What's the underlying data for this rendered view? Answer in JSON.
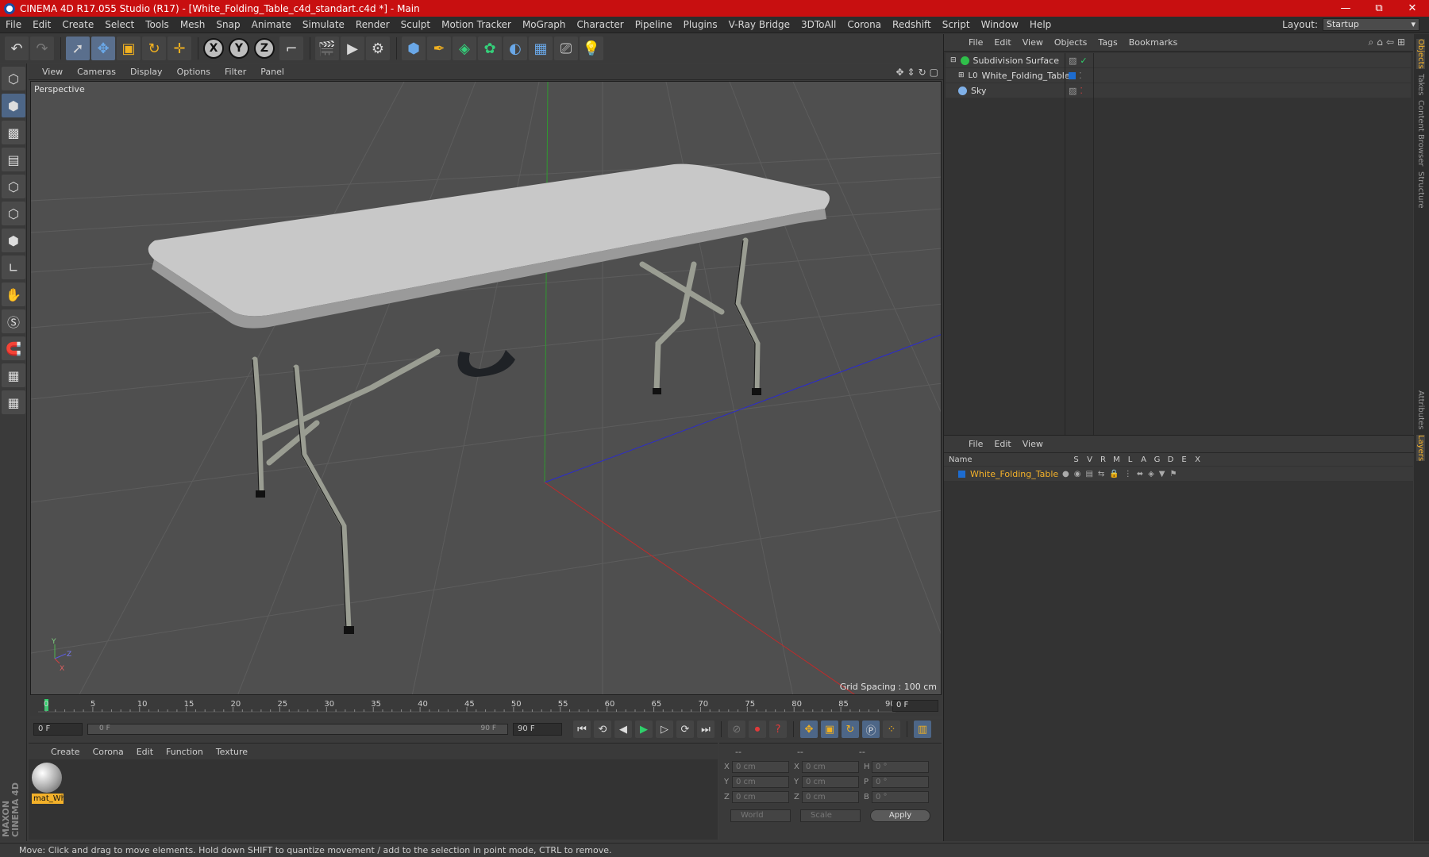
{
  "window": {
    "title": "CINEMA 4D R17.055 Studio (R17) - [White_Folding_Table_c4d_standart.c4d *] - Main",
    "controls": [
      "—",
      "⧉",
      "✕"
    ]
  },
  "menubar": {
    "items": [
      "File",
      "Edit",
      "Create",
      "Select",
      "Tools",
      "Mesh",
      "Snap",
      "Animate",
      "Simulate",
      "Render",
      "Sculpt",
      "Motion Tracker",
      "MoGraph",
      "Character",
      "Pipeline",
      "Plugins",
      "V-Ray Bridge",
      "3DToAll",
      "Corona",
      "Redshift",
      "Script",
      "Window",
      "Help"
    ],
    "layout_label": "Layout:",
    "layout_value": "Startup"
  },
  "toolbar": {
    "icons": [
      "undo-icon",
      "redo-icon",
      "select-icon",
      "move-icon",
      "scale-icon",
      "rotate-icon",
      "live-select-icon",
      "x-axis-icon",
      "y-axis-icon",
      "z-axis-icon",
      "coordinate-system-icon",
      "render-view-icon",
      "render-picture-viewer-icon",
      "render-settings-icon",
      "cube-icon",
      "pen-icon",
      "subdivision-icon",
      "array-icon",
      "deformer-icon",
      "floor-icon",
      "camera-icon",
      "light-icon"
    ],
    "axis_labels": [
      "X",
      "Y",
      "Z"
    ]
  },
  "viewport": {
    "menu": [
      "View",
      "Cameras",
      "Display",
      "Options",
      "Filter",
      "Panel"
    ],
    "label": "Perspective",
    "grid_spacing": "Grid Spacing : 100 cm",
    "axis_labels": [
      "Y",
      "Z",
      "X"
    ]
  },
  "timeline": {
    "ticks": [
      "0",
      "5",
      "10",
      "15",
      "20",
      "25",
      "30",
      "35",
      "40",
      "45",
      "50",
      "55",
      "60",
      "65",
      "70",
      "75",
      "80",
      "85",
      "90"
    ],
    "current_frame": "0 F"
  },
  "transport": {
    "start_field": "0 F",
    "slider_left": "0 F",
    "slider_right": "90 F",
    "end_field": "90 F"
  },
  "material_manager": {
    "menu": [
      "Create",
      "Corona",
      "Edit",
      "Function",
      "Texture"
    ],
    "material_name": "mat_Wh"
  },
  "coordinates": {
    "headers": [
      "--",
      "--",
      "--"
    ],
    "rows": [
      {
        "a": "X",
        "v1": "0 cm",
        "b": "X",
        "v2": "0 cm",
        "c": "H",
        "v3": "0 °"
      },
      {
        "a": "Y",
        "v1": "0 cm",
        "b": "Y",
        "v2": "0 cm",
        "c": "P",
        "v3": "0 °"
      },
      {
        "a": "Z",
        "v1": "0 cm",
        "b": "Z",
        "v2": "0 cm",
        "c": "B",
        "v3": "0 °"
      }
    ],
    "world": "World",
    "scale": "Scale",
    "apply": "Apply"
  },
  "object_manager": {
    "menu": [
      "File",
      "Edit",
      "View",
      "Objects",
      "Tags",
      "Bookmarks"
    ],
    "objects": [
      {
        "name": "Subdivision Surface",
        "color": "#2fbf4a"
      },
      {
        "name": "White_Folding_Table",
        "color": "#2f8fd8"
      },
      {
        "name": "Sky",
        "color": "#7fb0e8"
      }
    ]
  },
  "layer_manager": {
    "menu": [
      "File",
      "Edit",
      "View"
    ],
    "columns": [
      "Name",
      "S",
      "V",
      "R",
      "M",
      "L",
      "A",
      "G",
      "D",
      "E",
      "X"
    ],
    "layer_name": "White_Folding_Table",
    "layer_color": "#1d6cd0"
  },
  "side_tabs": [
    "Objects",
    "Takes",
    "Content Browser",
    "Structure",
    "Attributes",
    "Layers"
  ],
  "status": "Move: Click and drag to move elements. Hold down SHIFT to quantize movement / add to the selection in point mode, CTRL to remove.",
  "branding": "MAXON CINEMA 4D"
}
